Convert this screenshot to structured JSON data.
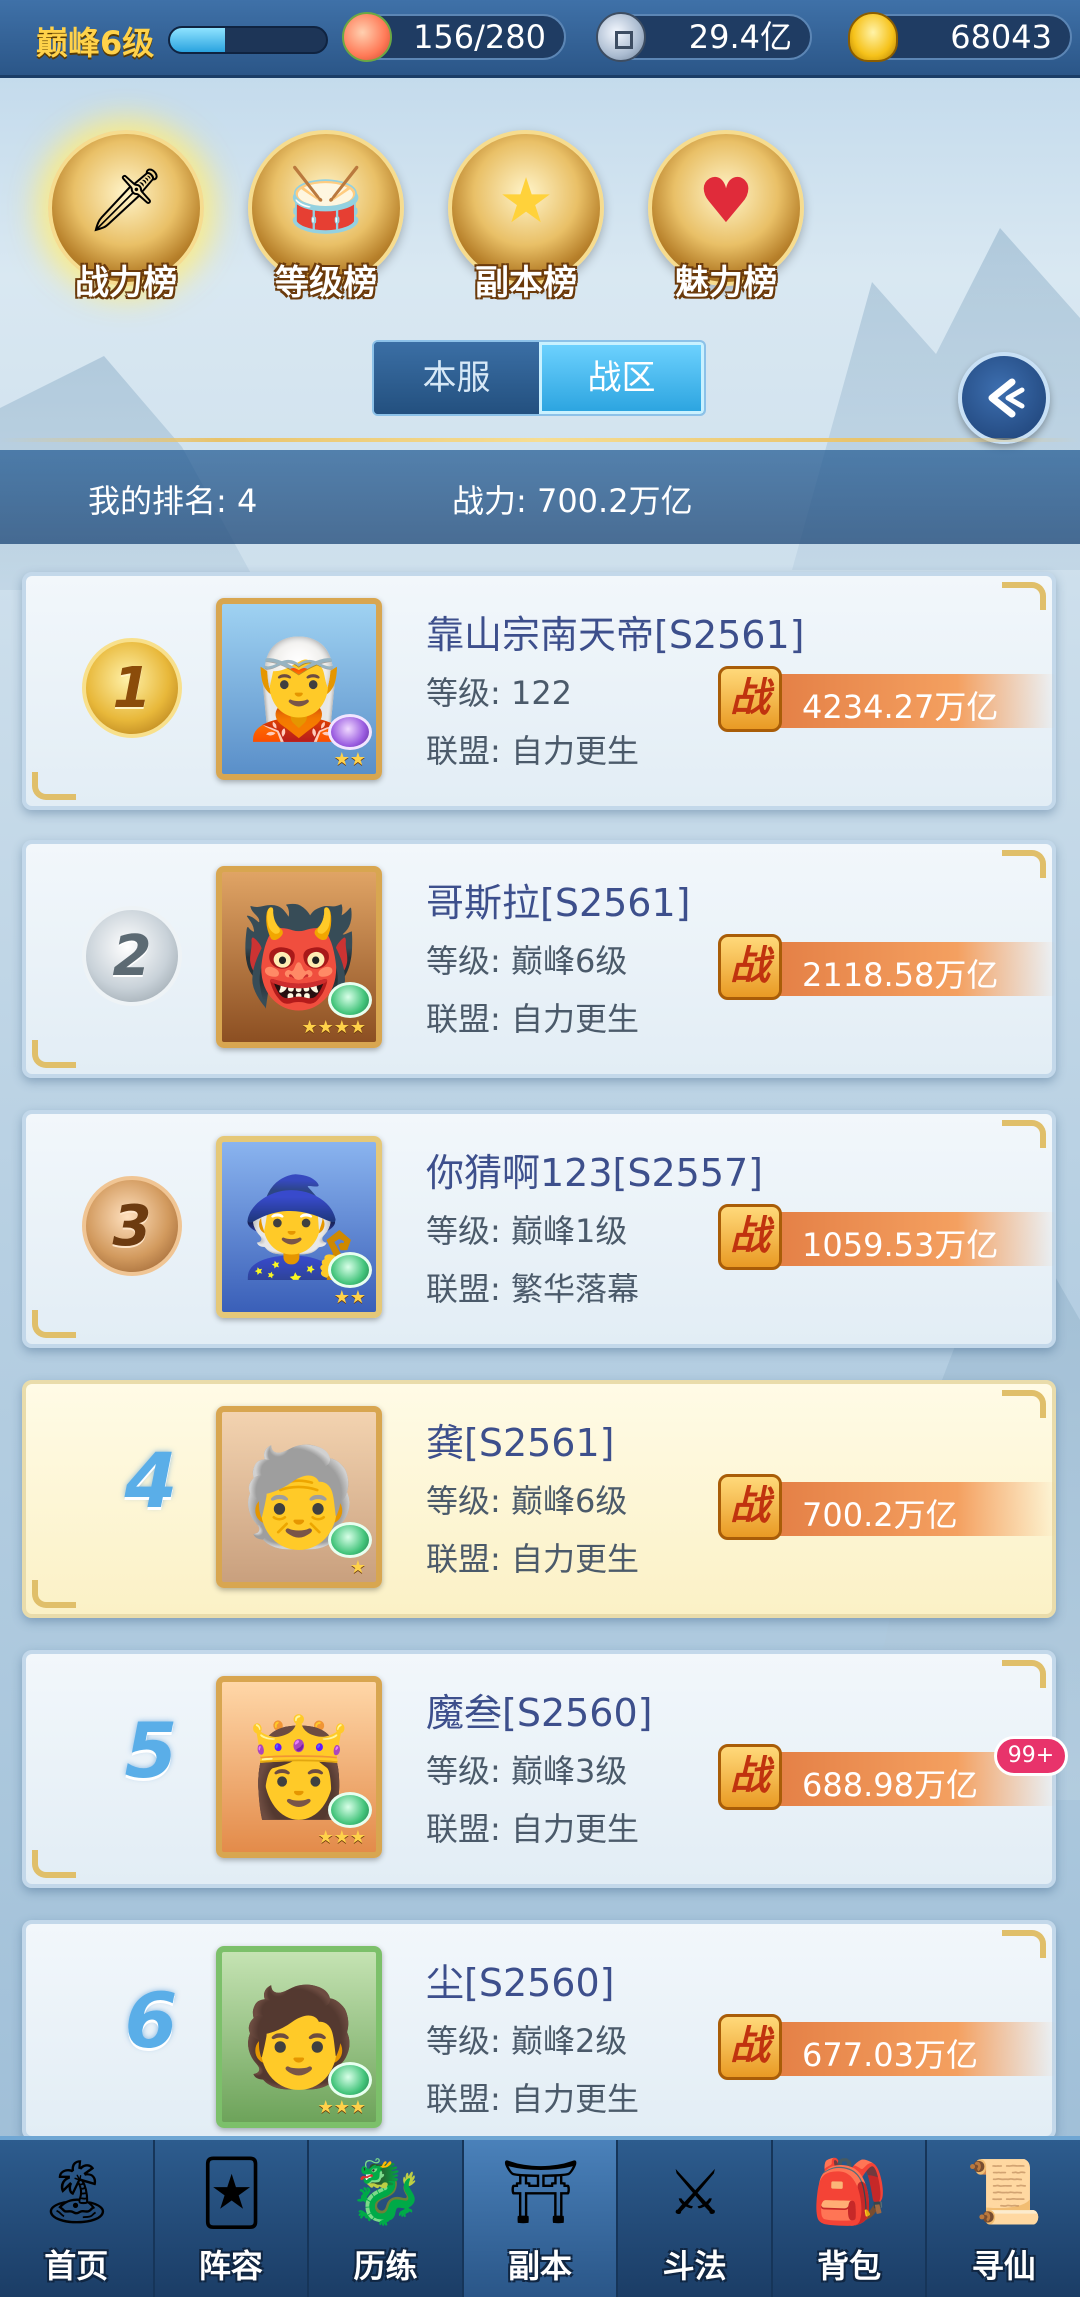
{
  "topbar": {
    "level_label": "巅峰6级",
    "level_progress": 0.35,
    "stamina": "156/280",
    "silver": "29.4亿",
    "gold": "68043"
  },
  "categories": [
    {
      "label": "战力榜",
      "icon": "sword-icon",
      "active": true
    },
    {
      "label": "等级榜",
      "icon": "drum-icon",
      "active": false
    },
    {
      "label": "副本榜",
      "icon": "stars-icon",
      "active": false
    },
    {
      "label": "魅力榜",
      "icon": "heart-icon",
      "active": false
    }
  ],
  "segment": {
    "local": "本服",
    "zone": "战区",
    "selected": "zone"
  },
  "my_rank": {
    "rank_text": "我的排名: 4",
    "power_text": "战力: 700.2万亿"
  },
  "rankings": [
    {
      "rank": "1",
      "name": "靠山宗南天帝[S2561]",
      "level": "等级: 122",
      "alliance": "联盟: 自力更生",
      "power": "4234.27万亿"
    },
    {
      "rank": "2",
      "name": "哥斯拉[S2561]",
      "level": "等级: 巅峰6级",
      "alliance": "联盟: 自力更生",
      "power": "2118.58万亿"
    },
    {
      "rank": "3",
      "name": "你猜啊123[S2557]",
      "level": "等级: 巅峰1级",
      "alliance": "联盟: 繁华落幕",
      "power": "1059.53万亿"
    },
    {
      "rank": "4",
      "name": "龚[S2561]",
      "level": "等级: 巅峰6级",
      "alliance": "联盟: 自力更生",
      "power": "700.2万亿"
    },
    {
      "rank": "5",
      "name": "魔叁[S2560]",
      "level": "等级: 巅峰3级",
      "alliance": "联盟: 自力更生",
      "power": "688.98万亿"
    },
    {
      "rank": "6",
      "name": "尘[S2560]",
      "level": "等级: 巅峰2级",
      "alliance": "联盟: 自力更生",
      "power": "677.03万亿"
    }
  ],
  "power_badge": "战",
  "notification": "99+",
  "bottom_nav": [
    {
      "label": "首页",
      "icon": "island-icon"
    },
    {
      "label": "阵容",
      "icon": "cards-icon"
    },
    {
      "label": "历练",
      "icon": "dragon-icon"
    },
    {
      "label": "副本",
      "icon": "gate-icon"
    },
    {
      "label": "斗法",
      "icon": "crossed-swords-icon"
    },
    {
      "label": "背包",
      "icon": "bag-icon"
    },
    {
      "label": "寻仙",
      "icon": "scroll-icon"
    }
  ]
}
